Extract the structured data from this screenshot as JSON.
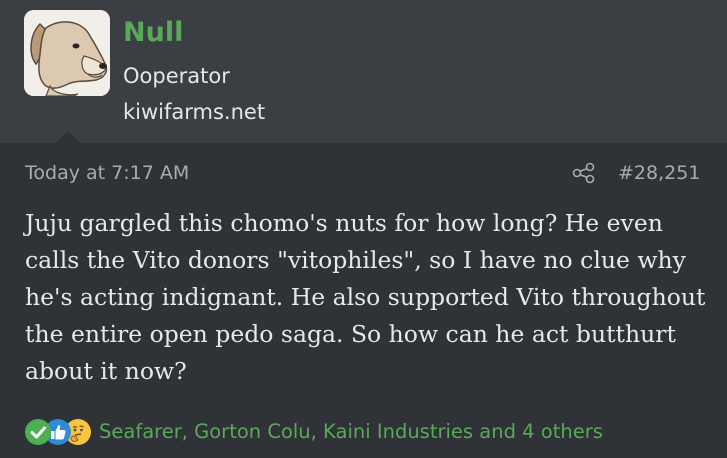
{
  "user": {
    "name": "Null",
    "title": "Ooperator",
    "banner": "kiwifarms.net",
    "avatar_icon": "dog-avatar-icon"
  },
  "post": {
    "date": "Today at 7:17 AM",
    "number": "#28,251",
    "share_icon": "share-icon",
    "body": "Juju gargled this chomo's nuts for how long? He even calls the Vito donors \"vitophiles\", so I have no clue why he's acting indignant. He also supported Vito throughout the entire open pedo saga. So how can he act butthurt about it now?"
  },
  "reactions": {
    "icons": [
      "check-icon",
      "thumbs-up-icon",
      "thinking-face-icon"
    ],
    "users_text": "Seafarer, Gorton Colu, Kaini Industries and 4 others"
  },
  "colors": {
    "header_bg": "#3b3e42",
    "post_bg": "#2f3236",
    "username": "#5aa85a",
    "meta_text": "#a9abae",
    "body_text": "#e8e8e8",
    "reaction_link": "#5aa85a"
  }
}
